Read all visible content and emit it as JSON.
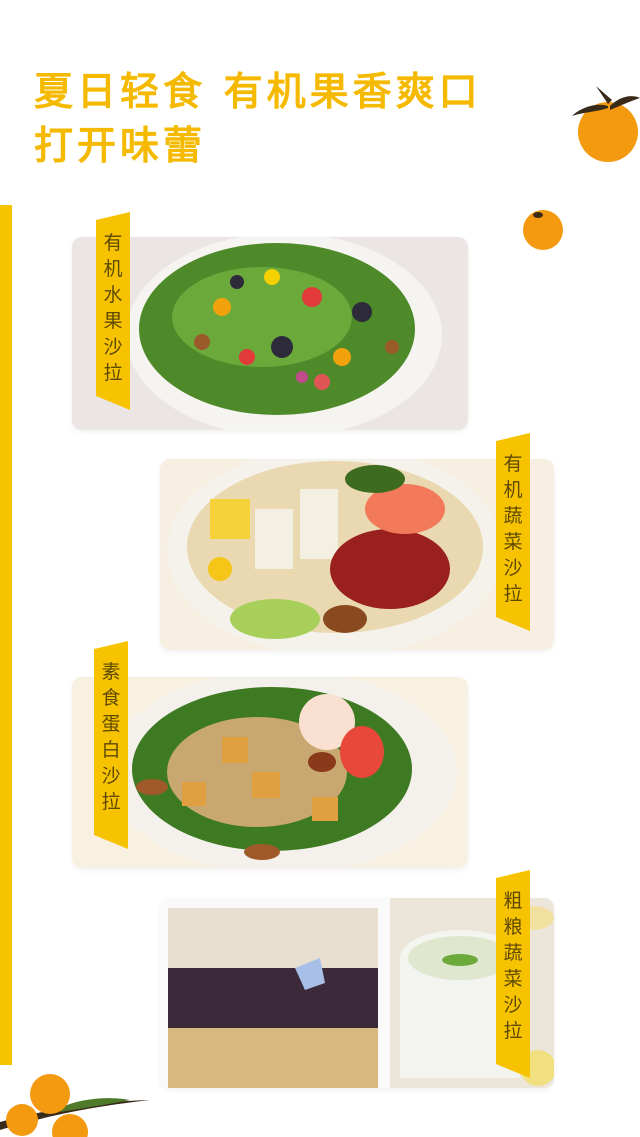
{
  "headline": {
    "line1": "夏日轻食 有机果香爽口",
    "line2": "打开味蕾"
  },
  "cards": [
    {
      "name": "有机水果沙拉"
    },
    {
      "name": "有机蔬菜沙拉"
    },
    {
      "name": "素食蛋白沙拉"
    },
    {
      "name": "粗粮蔬菜沙拉"
    }
  ],
  "colors": {
    "accent": "#f7c300",
    "headline": "#f5ba00",
    "orange": "#f39a10",
    "leaf": "#3d6b1f"
  },
  "icons": [
    "orange-fruit-icon",
    "small-orange-icon",
    "orange-branch-icon"
  ]
}
